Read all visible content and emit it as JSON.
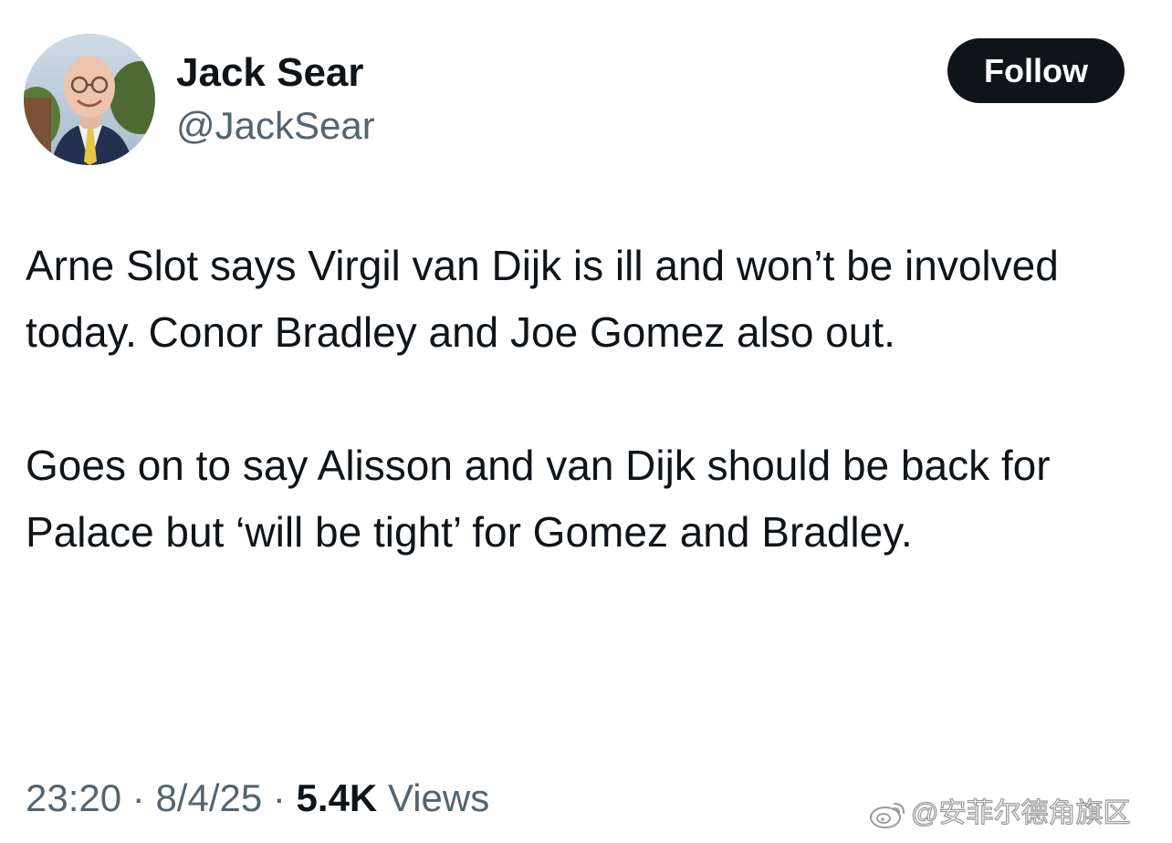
{
  "author": {
    "display_name": "Jack Sear",
    "handle": "@JackSear"
  },
  "follow_button": {
    "label": "Follow"
  },
  "tweet": {
    "paragraphs": [
      "Arne Slot says Virgil van Dijk is ill and won’t be involved today. Conor Bradley and Joe Gomez also out.",
      "Goes on to say Alisson and van Dijk should be back for Palace but ‘will be tight’ for Gomez and Bradley."
    ]
  },
  "meta": {
    "time": "23:20",
    "separator": "·",
    "date": "8/4/25",
    "views_count": "5.4K",
    "views_label": "Views"
  },
  "watermark": {
    "text": "@安菲尔德角旗区",
    "icon": "weibo-icon"
  },
  "colors": {
    "text_primary": "#0f1419",
    "text_secondary": "#536471",
    "button_bg": "#0f1419",
    "button_text": "#ffffff"
  }
}
